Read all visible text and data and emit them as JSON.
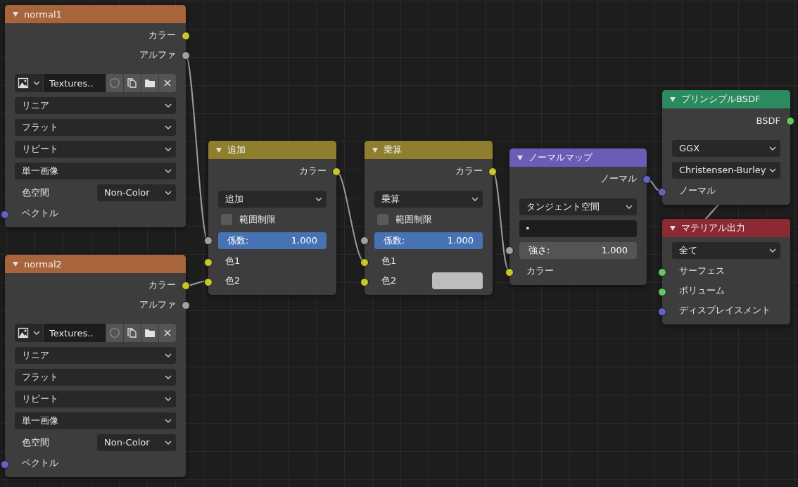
{
  "nodes": [
    {
      "title": "normal1",
      "color": "#a8643a",
      "rows": [
        {
          "kind": "output",
          "label": "カラー",
          "color": "#c7c729"
        },
        {
          "kind": "output",
          "label": "アルファ",
          "color": "#a1a1a1"
        },
        {
          "kind": "image",
          "value": "Textures.."
        },
        {
          "kind": "dropdown",
          "value": "リニア"
        },
        {
          "kind": "dropdown",
          "value": "フラット"
        },
        {
          "kind": "dropdown",
          "value": "リピート"
        },
        {
          "kind": "dropdown",
          "value": "単一画像"
        },
        {
          "kind": "prop",
          "label": "色空間",
          "value": "Non-Color"
        },
        {
          "kind": "input",
          "label": "ベクトル",
          "color": "#6363c7"
        }
      ]
    },
    {
      "title": "normal2",
      "color": "#a8643a",
      "rows": [
        {
          "kind": "output",
          "label": "カラー",
          "color": "#c7c729"
        },
        {
          "kind": "output",
          "label": "アルファ",
          "color": "#a1a1a1"
        },
        {
          "kind": "image",
          "value": "Textures.."
        },
        {
          "kind": "dropdown",
          "value": "リニア"
        },
        {
          "kind": "dropdown",
          "value": "フラット"
        },
        {
          "kind": "dropdown",
          "value": "リピート"
        },
        {
          "kind": "dropdown",
          "value": "単一画像"
        },
        {
          "kind": "prop",
          "label": "色空間",
          "value": "Non-Color"
        },
        {
          "kind": "input",
          "label": "ベクトル",
          "color": "#6363c7"
        }
      ]
    },
    {
      "title": "追加",
      "color": "#8e7e2e",
      "rows": [
        {
          "kind": "output",
          "label": "カラー",
          "color": "#c7c729"
        },
        {
          "kind": "dropdown",
          "value": "追加"
        },
        {
          "kind": "checkbox",
          "label": "範囲制限",
          "checked": false
        },
        {
          "kind": "slider",
          "label": "係数:",
          "value": "1.000",
          "level": 1,
          "color": "#a1a1a1"
        },
        {
          "kind": "input",
          "label": "色1",
          "color": "#c7c729"
        },
        {
          "kind": "input",
          "label": "色2",
          "color": "#c7c729"
        }
      ]
    },
    {
      "title": "乗算",
      "color": "#8e7e2e",
      "rows": [
        {
          "kind": "output",
          "label": "カラー",
          "color": "#c7c729"
        },
        {
          "kind": "dropdown",
          "value": "乗算"
        },
        {
          "kind": "checkbox",
          "label": "範囲制限",
          "checked": false
        },
        {
          "kind": "slider",
          "label": "係数:",
          "value": "1.000",
          "level": 1,
          "color": "#a1a1a1"
        },
        {
          "kind": "input",
          "label": "色1",
          "color": "#c7c729"
        },
        {
          "kind": "swatch",
          "label": "色2",
          "color": "#c7c729"
        }
      ]
    },
    {
      "title": "ノーマルマップ",
      "color": "#6d5bb8",
      "rows": [
        {
          "kind": "output",
          "label": "ノーマル",
          "color": "#6363c7"
        },
        {
          "kind": "dropdown",
          "value": "タンジェント空間"
        },
        {
          "kind": "field",
          "value": "•"
        },
        {
          "kind": "number",
          "label": "強さ:",
          "value": "1.000",
          "color": "#a1a1a1"
        },
        {
          "kind": "input",
          "label": "カラー",
          "color": "#c7c729"
        }
      ]
    },
    {
      "title": "プリンシプルBSDF",
      "color": "#2a8c5e",
      "rows": [
        {
          "kind": "output",
          "label": "BSDF",
          "color": "#63c763"
        },
        {
          "kind": "dropdown",
          "value": "GGX"
        },
        {
          "kind": "dropdown",
          "value": "Christensen-Burley"
        },
        {
          "kind": "input",
          "label": "ノーマル",
          "color": "#6363c7"
        }
      ]
    },
    {
      "title": "マテリアル出力",
      "color": "#8c2a33",
      "rows": [
        {
          "kind": "dropdown",
          "value": "全て"
        },
        {
          "kind": "input",
          "label": "サーフェス",
          "color": "#63c763"
        },
        {
          "kind": "input",
          "label": "ボリューム",
          "color": "#63c763"
        },
        {
          "kind": "input",
          "label": "ディスプレイスメント",
          "color": "#6363c7"
        }
      ]
    }
  ]
}
